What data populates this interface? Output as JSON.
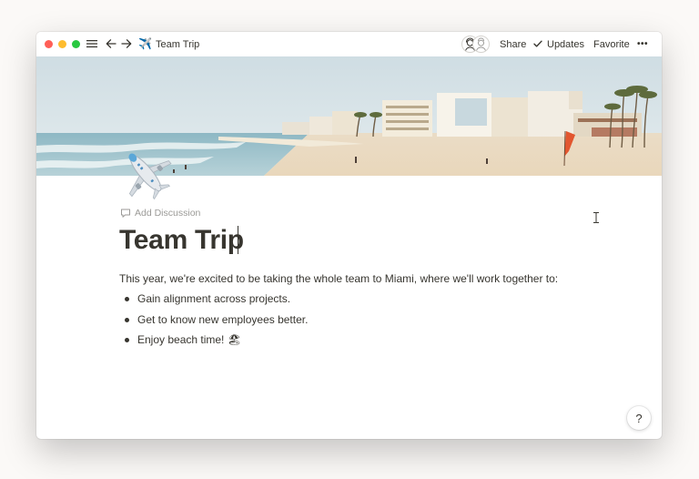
{
  "titlebar": {
    "page_emoji": "✈️",
    "page_title": "Team Trip",
    "share_label": "Share",
    "updates_label": "Updates",
    "favorite_label": "Favorite",
    "more_label": "•••"
  },
  "page": {
    "icon": "airplane-emoji",
    "add_discussion_label": "Add Discussion",
    "title": "Team Trip",
    "intro": "This year, we're excited to be taking the whole team to Miami, where we'll work together to:",
    "bullets": [
      {
        "text": "Gain alignment across projects."
      },
      {
        "text": "Get to know new employees better."
      },
      {
        "text": "Enjoy beach time! 🏖"
      }
    ]
  },
  "help_label": "?",
  "colors": {
    "text": "#37352f",
    "muted": "#9b9a97",
    "close": "#ff5f57",
    "minimize": "#febc2e",
    "zoom": "#28c840"
  }
}
